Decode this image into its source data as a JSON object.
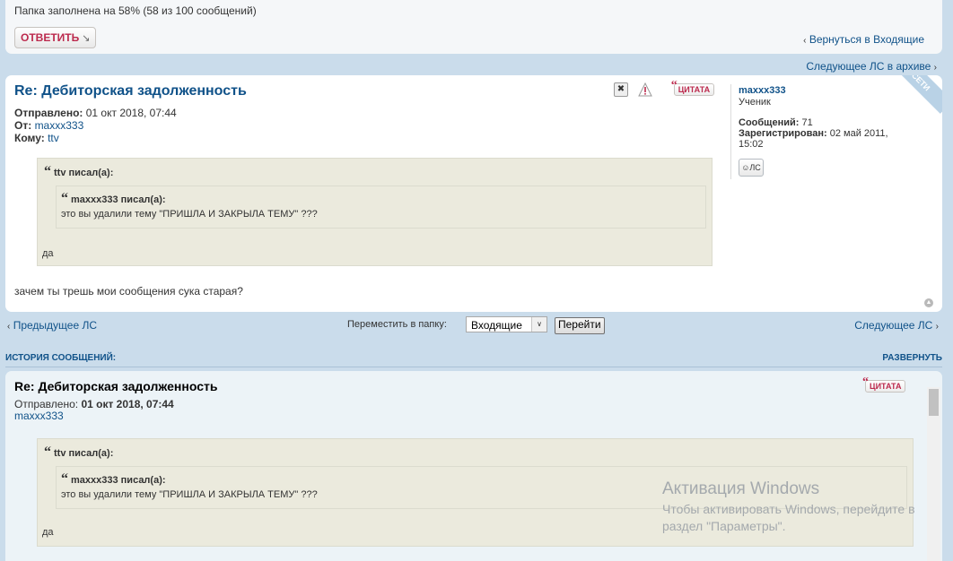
{
  "top": {
    "folder_status": "Папка заполнена на 58% (58 из 100 сообщений)",
    "reply_label": "ОТВЕТИТЬ",
    "back_link": "Вернуться в Входящие",
    "next_archive": "Следующее ЛС в архиве"
  },
  "post": {
    "title": "Re: Дебиторская задолженность",
    "sent_label": "Отправлено:",
    "sent_value": "01 окт 2018, 07:44",
    "from_label": "От:",
    "from_value": "maxxx333",
    "to_label": "Кому:",
    "to_value": "ttv",
    "quote_label": "ЦИТАТА",
    "outer_cite": "ttv писал(а):",
    "inner_cite": "maxxx333 писал(а):",
    "inner_text": "это вы удалили тему \"ПРИШЛА И ЗАКРЫЛА ТЕМУ\" ???",
    "outer_text": "да",
    "body": "зачем ты трешь мои сообщения сука старая?"
  },
  "profile": {
    "name": "maxxx333",
    "rank": "Ученик",
    "posts_label": "Сообщений:",
    "posts_value": "71",
    "registered_label": "Зарегистрирован:",
    "registered_value": "02 май 2011,",
    "registered_time": "15:02",
    "online_badge": "В СЕТИ",
    "pm_label": "ЛС"
  },
  "nav": {
    "prev": "Предыдущее ЛС",
    "move_label": "Переместить в папку:",
    "folder_selected": "Входящие",
    "go_label": "Перейти",
    "next": "Следующее ЛС"
  },
  "history": {
    "title": "ИСТОРИЯ СООБЩЕНИЙ:",
    "expand": "РАЗВЕРНУТЬ",
    "post_title": "Re: Дебиторская задолженность",
    "sent_label": "Отправлено:",
    "sent_value": "01 окт 2018, 07:44",
    "author": "maxxx333",
    "quote_label": "ЦИТАТА",
    "outer_cite": "ttv писал(а):",
    "inner_cite": "maxxx333 писал(а):",
    "inner_text": "это вы удалили тему \"ПРИШЛА И ЗАКРЫЛА ТЕМУ\" ???",
    "outer_text": "да"
  },
  "watermark": {
    "title": "Активация Windows",
    "line1": "Чтобы активировать Windows, перейдите в",
    "line2": "раздел \"Параметры\"."
  },
  "colors": {
    "background": "#cadceb",
    "link": "#105289",
    "accent_red": "#bc2a4d",
    "quote_bg": "#ebeadd"
  }
}
